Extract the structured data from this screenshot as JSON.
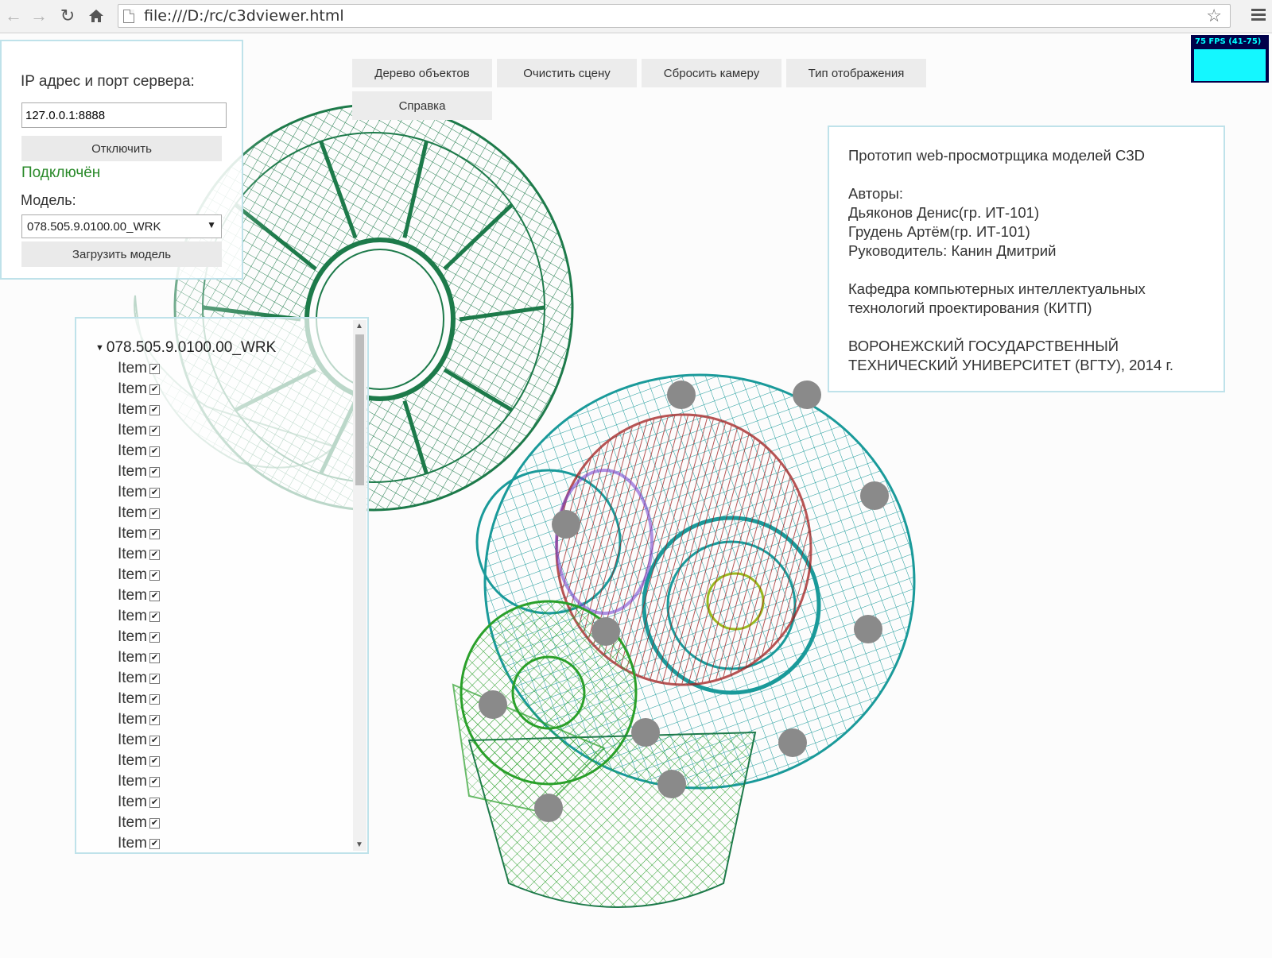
{
  "browser": {
    "url": "file:///D:/rc/c3dviewer.html"
  },
  "fps": {
    "text": "75 FPS (41-75)"
  },
  "connection": {
    "ip_label": "IP адрес и порт сервера:",
    "ip_value": "127.0.0.1:8888",
    "disconnect_label": "Отключить",
    "status": "Подключён",
    "model_label": "Модель:",
    "model_selected": "078.505.9.0100.00_WRK",
    "load_label": "Загрузить модель"
  },
  "toolbar": {
    "tree": "Дерево объектов",
    "clear": "Очистить сцену",
    "reset": "Сбросить камеру",
    "display": "Тип отображения",
    "help": "Справка"
  },
  "info": {
    "title": "Прототип web-просмотрщика моделей C3D",
    "authors_label": "Авторы:",
    "author1": "Дьяконов Денис(гр. ИТ-101)",
    "author2": "Грудень Артём(гр. ИТ-101)",
    "supervisor": "Руководитель: Канин Дмитрий",
    "dept1": "Кафедра компьютерных интеллектуальных",
    "dept2": "технологий проектирования (КИТП)",
    "univ1": "ВОРОНЕЖСКИЙ ГОСУДАРСТВЕННЫЙ",
    "univ2": "ТЕХНИЧЕСКИЙ УНИВЕРСИТЕТ (ВГТУ), 2014 г."
  },
  "tree": {
    "root": "078.505.9.0100.00_WRK",
    "items": [
      "Item",
      "Item",
      "Item",
      "Item",
      "Item",
      "Item",
      "Item",
      "Item",
      "Item",
      "Item",
      "Item",
      "Item",
      "Item",
      "Item",
      "Item",
      "Item",
      "Item",
      "Item",
      "Item",
      "Item",
      "Item",
      "Item",
      "Item",
      "Item"
    ]
  },
  "colors": {
    "part_green": "#1d7a4a",
    "part_teal": "#1a9a9a",
    "part_lime": "#2aa02a",
    "part_red": "#a01c1c",
    "bolt_gray": "#8a8a8a"
  }
}
